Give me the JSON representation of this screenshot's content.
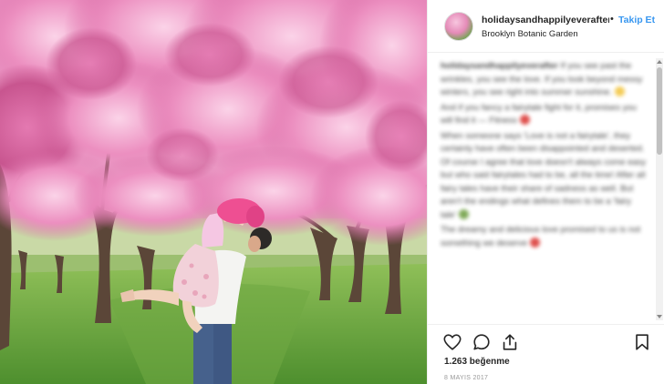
{
  "post": {
    "username": "holidaysandhappilyeverafter",
    "follow_separator": "•",
    "follow_label": "Takip Et",
    "location": "Brooklyn Botanic Garden",
    "likes": "1.263 beğenme",
    "date": "8 MAYIS 2017"
  },
  "caption": {
    "author": "holidaysandhappilyeverafter",
    "paragraphs": [
      "If you see past the wrinkles, you see the love. If you look beyond messy winters, you see right into summer sunshine.",
      "And if you fancy a fairytale fight for it, promises you will find it — Fitness",
      "When someone says 'Love is not a fairytale', they certainly have often been disappointed and deserted. Of course I agree that love doesn't always come easy but who said fairytales had to be, all the time! After all fairy tales have their share of sadness as well. But aren't the endings what defines them to be a 'fairy tale'",
      "The dreamy and delicious love promised to us is not something we deserve"
    ]
  },
  "icons": {
    "like": "heart-icon",
    "comment": "comment-icon",
    "share": "share-icon",
    "save": "bookmark-icon"
  },
  "colors": {
    "link": "#3897f0",
    "text": "#262626",
    "muted": "#999999"
  }
}
